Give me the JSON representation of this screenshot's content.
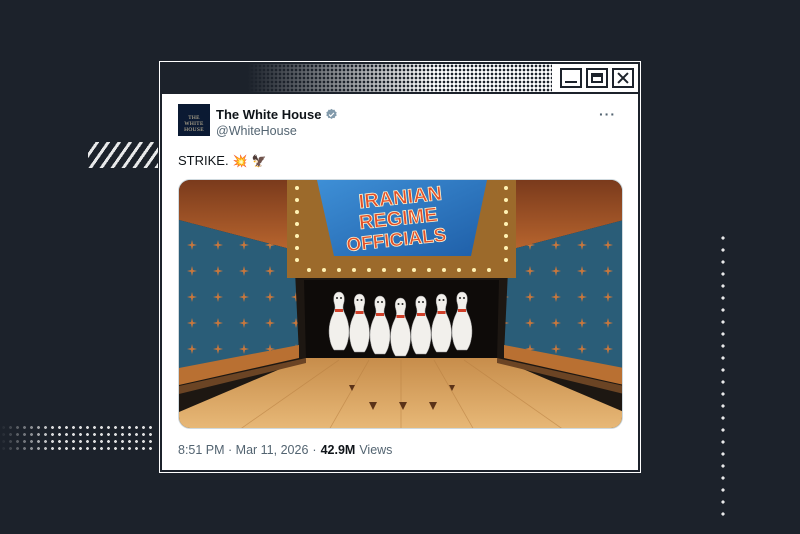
{
  "tweet": {
    "display_name": "The White House",
    "handle": "@WhiteHouse",
    "avatar_text": "THE WHITE HOUSE",
    "text": "STRIKE.",
    "emojis": [
      "💥",
      "🦅"
    ],
    "media": {
      "sign_lines": [
        "IRANIAN",
        "REGIME",
        "OFFICIALS"
      ],
      "pin_count": 7
    },
    "timestamp": "8:51 PM · Mar 11, 2026",
    "separator": "·",
    "views_count": "42.9M",
    "views_label": "Views"
  },
  "icons": {
    "verified": "verified-badge-icon",
    "more": "more-options-icon",
    "minimize": "minimize-icon",
    "maximize": "maximize-icon",
    "close": "close-icon"
  },
  "colors": {
    "background": "#1c222b",
    "verified_grey": "#829aab",
    "sign_text": "#e2502a",
    "lane_wood": "#d9a460",
    "wall_teal": "#2a5d78"
  }
}
